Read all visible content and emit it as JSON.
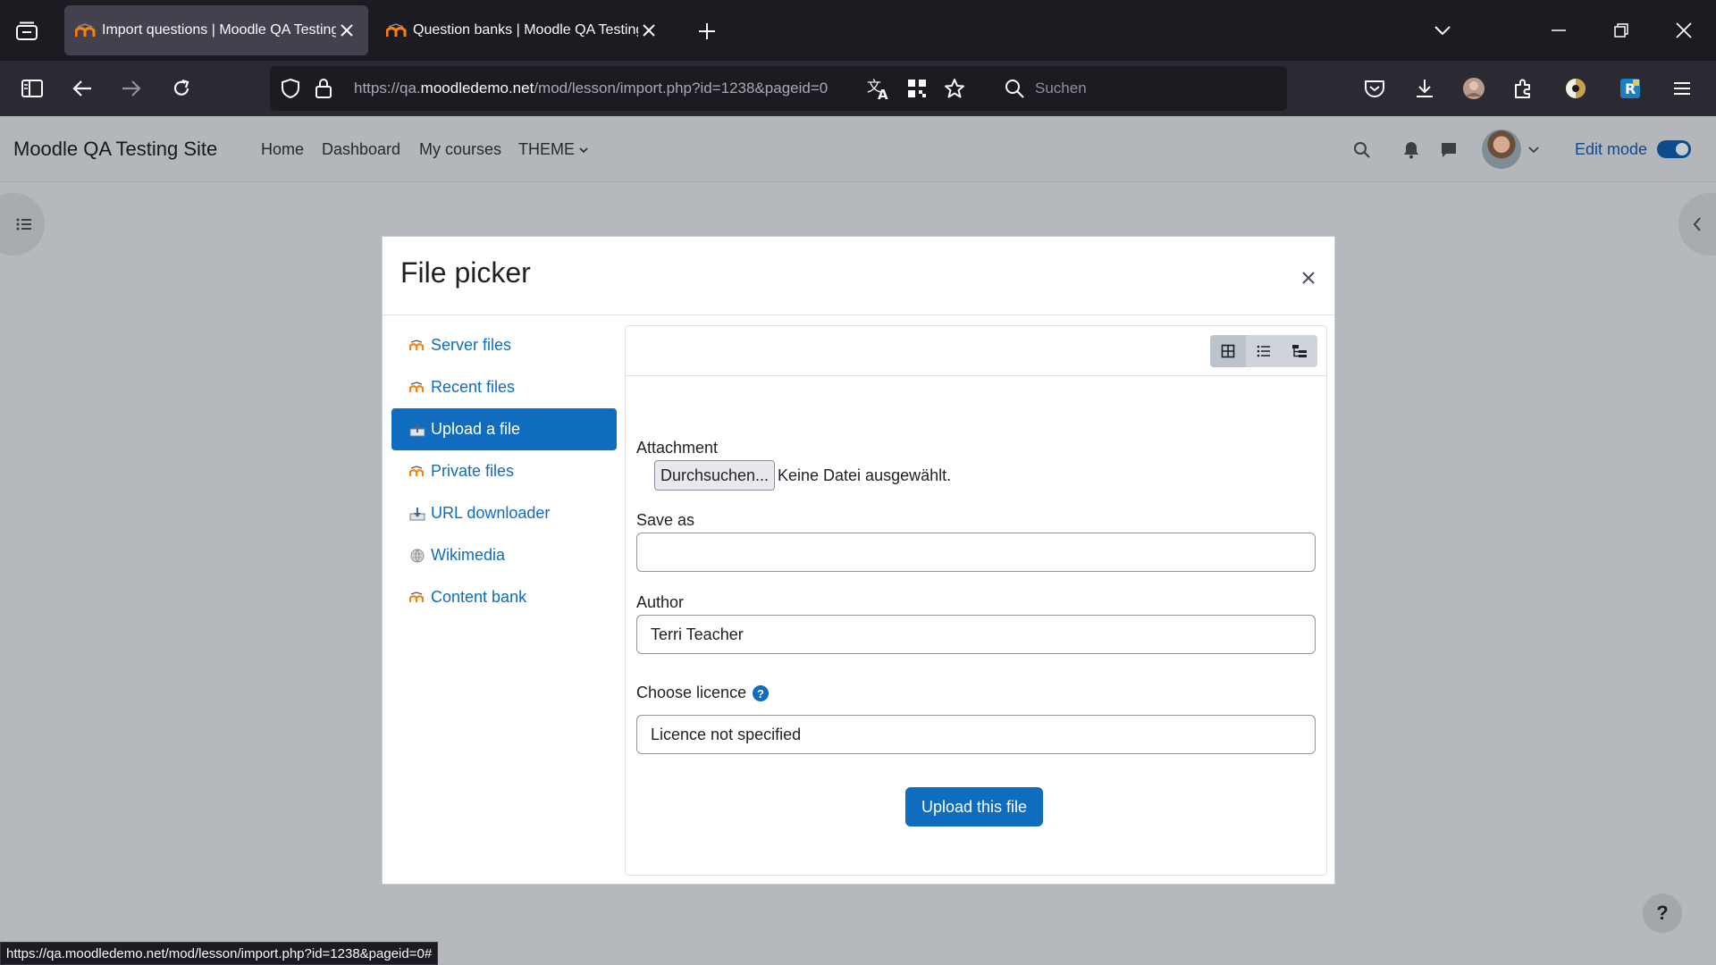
{
  "browser": {
    "tabs": [
      {
        "title": "Import questions | Moodle QA Testing Site",
        "active": true
      },
      {
        "title": "Question banks | Moodle QA Testing Site",
        "active": false
      }
    ],
    "url_prefix": "https://qa.",
    "url_domain": "moodledemo.net",
    "url_path": "/mod/lesson/import.php?id=1238&pageid=0",
    "search_placeholder": "Suchen",
    "status_url": "https://qa.moodledemo.net/mod/lesson/import.php?id=1238&pageid=0#"
  },
  "moodle": {
    "site_name": "Moodle QA Testing Site",
    "primary_nav": [
      "Home",
      "Dashboard",
      "My courses",
      "THEME"
    ],
    "edit_mode_label": "Edit mode",
    "edit_mode_on": true,
    "help_button": "?"
  },
  "file_picker": {
    "title": "File picker",
    "repositories": [
      {
        "label": "Server files",
        "icon": "moodle-icon",
        "active": false
      },
      {
        "label": "Recent files",
        "icon": "moodle-icon",
        "active": false
      },
      {
        "label": "Upload a file",
        "icon": "upload-icon",
        "active": true
      },
      {
        "label": "Private files",
        "icon": "moodle-icon",
        "active": false
      },
      {
        "label": "URL downloader",
        "icon": "url-downloader-icon",
        "active": false
      },
      {
        "label": "Wikimedia",
        "icon": "wikimedia-icon",
        "active": false
      },
      {
        "label": "Content bank",
        "icon": "moodle-icon",
        "active": false
      }
    ],
    "views": [
      "icons-view",
      "list-view",
      "tree-view"
    ],
    "attachment_label": "Attachment",
    "browse_button": "Durchsuchen...",
    "no_file_selected": "Keine Datei ausgewählt.",
    "save_as_label": "Save as",
    "save_as_value": "",
    "author_label": "Author",
    "author_value": "Terri Teacher",
    "licence_label": "Choose licence",
    "licence_value": "Licence not specified",
    "upload_button": "Upload this file"
  },
  "colors": {
    "accent": "#0f6cbf",
    "chrome_dark": "#1c1b22",
    "backdrop": "#b5b9bd"
  }
}
